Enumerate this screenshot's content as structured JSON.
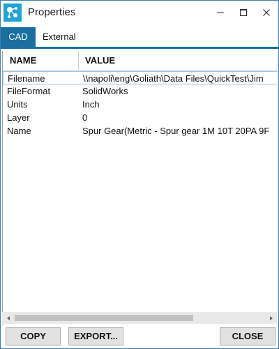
{
  "window": {
    "title": "Properties",
    "controls": {
      "minimize_icon": "minimize-icon",
      "maximize_icon": "maximize-icon",
      "close_icon": "close-icon"
    },
    "app_icon": "molecule-app-icon"
  },
  "tabs": [
    {
      "label": "CAD",
      "active": true
    },
    {
      "label": "External",
      "active": false
    }
  ],
  "grid": {
    "columns": [
      "NAME",
      "VALUE"
    ],
    "rows": [
      {
        "name": "Filename",
        "value": "\\\\napoli\\eng\\Goliath\\Data Files\\QuickTest\\Jim",
        "selected": true
      },
      {
        "name": "FileFormat",
        "value": "SolidWorks",
        "selected": false
      },
      {
        "name": "Units",
        "value": "Inch",
        "selected": false
      },
      {
        "name": "Layer",
        "value": "0",
        "selected": false
      },
      {
        "name": "Name",
        "value": "Spur Gear(Metric - Spur gear 1M 10T 20PA 9F",
        "selected": false
      }
    ]
  },
  "buttons": {
    "copy": "COPY",
    "export": "EXPORT...",
    "close": "CLOSE"
  },
  "colors": {
    "accent": "#1a6fa0",
    "icon_bg": "#1fa3d9",
    "button_bg": "#e1e1e1"
  }
}
